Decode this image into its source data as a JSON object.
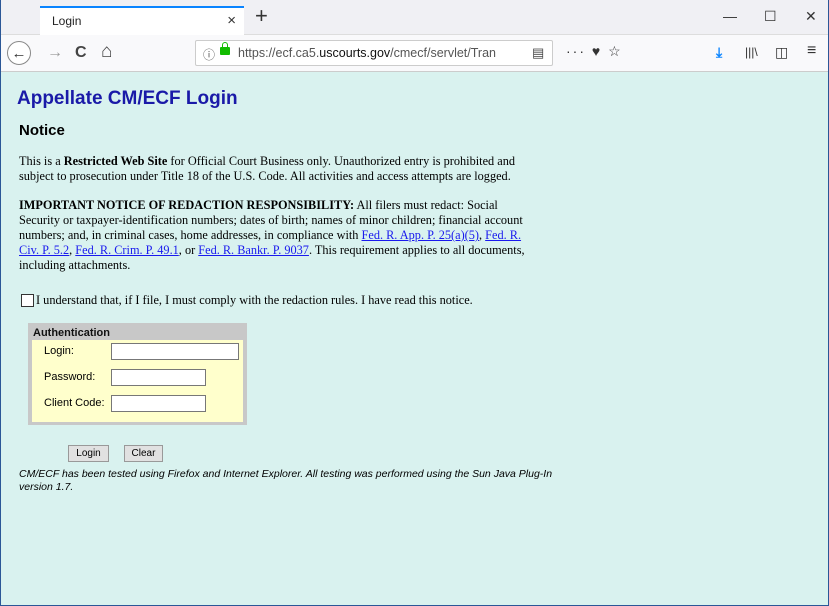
{
  "browser": {
    "tab_title": "Login",
    "tab_close": "×",
    "new_tab": "+",
    "minimize": "—",
    "maximize": "☐",
    "close": "✕",
    "back": "←",
    "forward": "→",
    "reload": "C",
    "home": "⌂",
    "url_info": "ⓘ",
    "url_prefix": "https://ecf.ca5.",
    "url_domain": "uscourts.gov",
    "url_path": "/cmecf/servlet/Trans",
    "reader": "▤",
    "page_actions": "··· ♥ ☆",
    "download": "⤓",
    "library": "|||\\",
    "sidebar": "◫",
    "menu": "≡"
  },
  "page": {
    "title": "Appellate CM/ECF Login",
    "notice_heading": "Notice",
    "restricted": {
      "pre": "This is a ",
      "bold": "Restricted Web Site",
      "post": " for Official Court Business only. Unauthorized entry is prohibited and subject to prosecution under Title 18 of the U.S. Code. All activities and access attempts are logged."
    },
    "redaction": {
      "bold": "IMPORTANT NOTICE OF REDACTION RESPONSIBILITY:",
      "text1": " All filers must redact: Social Security or taxpayer-identification numbers; dates of birth; names of minor children; financial account numbers; and, in criminal cases, home addresses, in compliance with ",
      "link1": "Fed. R. App. P. 25(a)(5)",
      "sep1": ", ",
      "link2": "Fed. R. Civ. P. 5.2",
      "sep2": ", ",
      "link3": "Fed. R. Crim. P. 49.1",
      "sep3": ", or ",
      "link4": "Fed. R. Bankr. P. 9037",
      "text2": ". This requirement applies to all documents, including attachments."
    },
    "agree_label": "I understand that, if I file, I must comply with the redaction rules. I have read this notice.",
    "auth": {
      "title": "Authentication",
      "login_label": "Login:",
      "password_label": "Password:",
      "client_label": "Client Code:",
      "login_value": "",
      "password_value": "",
      "client_value": ""
    },
    "login_button": "Login",
    "clear_button": "Clear",
    "footnote": "CM/ECF has been tested using Firefox and Internet Explorer. All testing was performed using the Sun Java Plug-In version 1.7."
  }
}
